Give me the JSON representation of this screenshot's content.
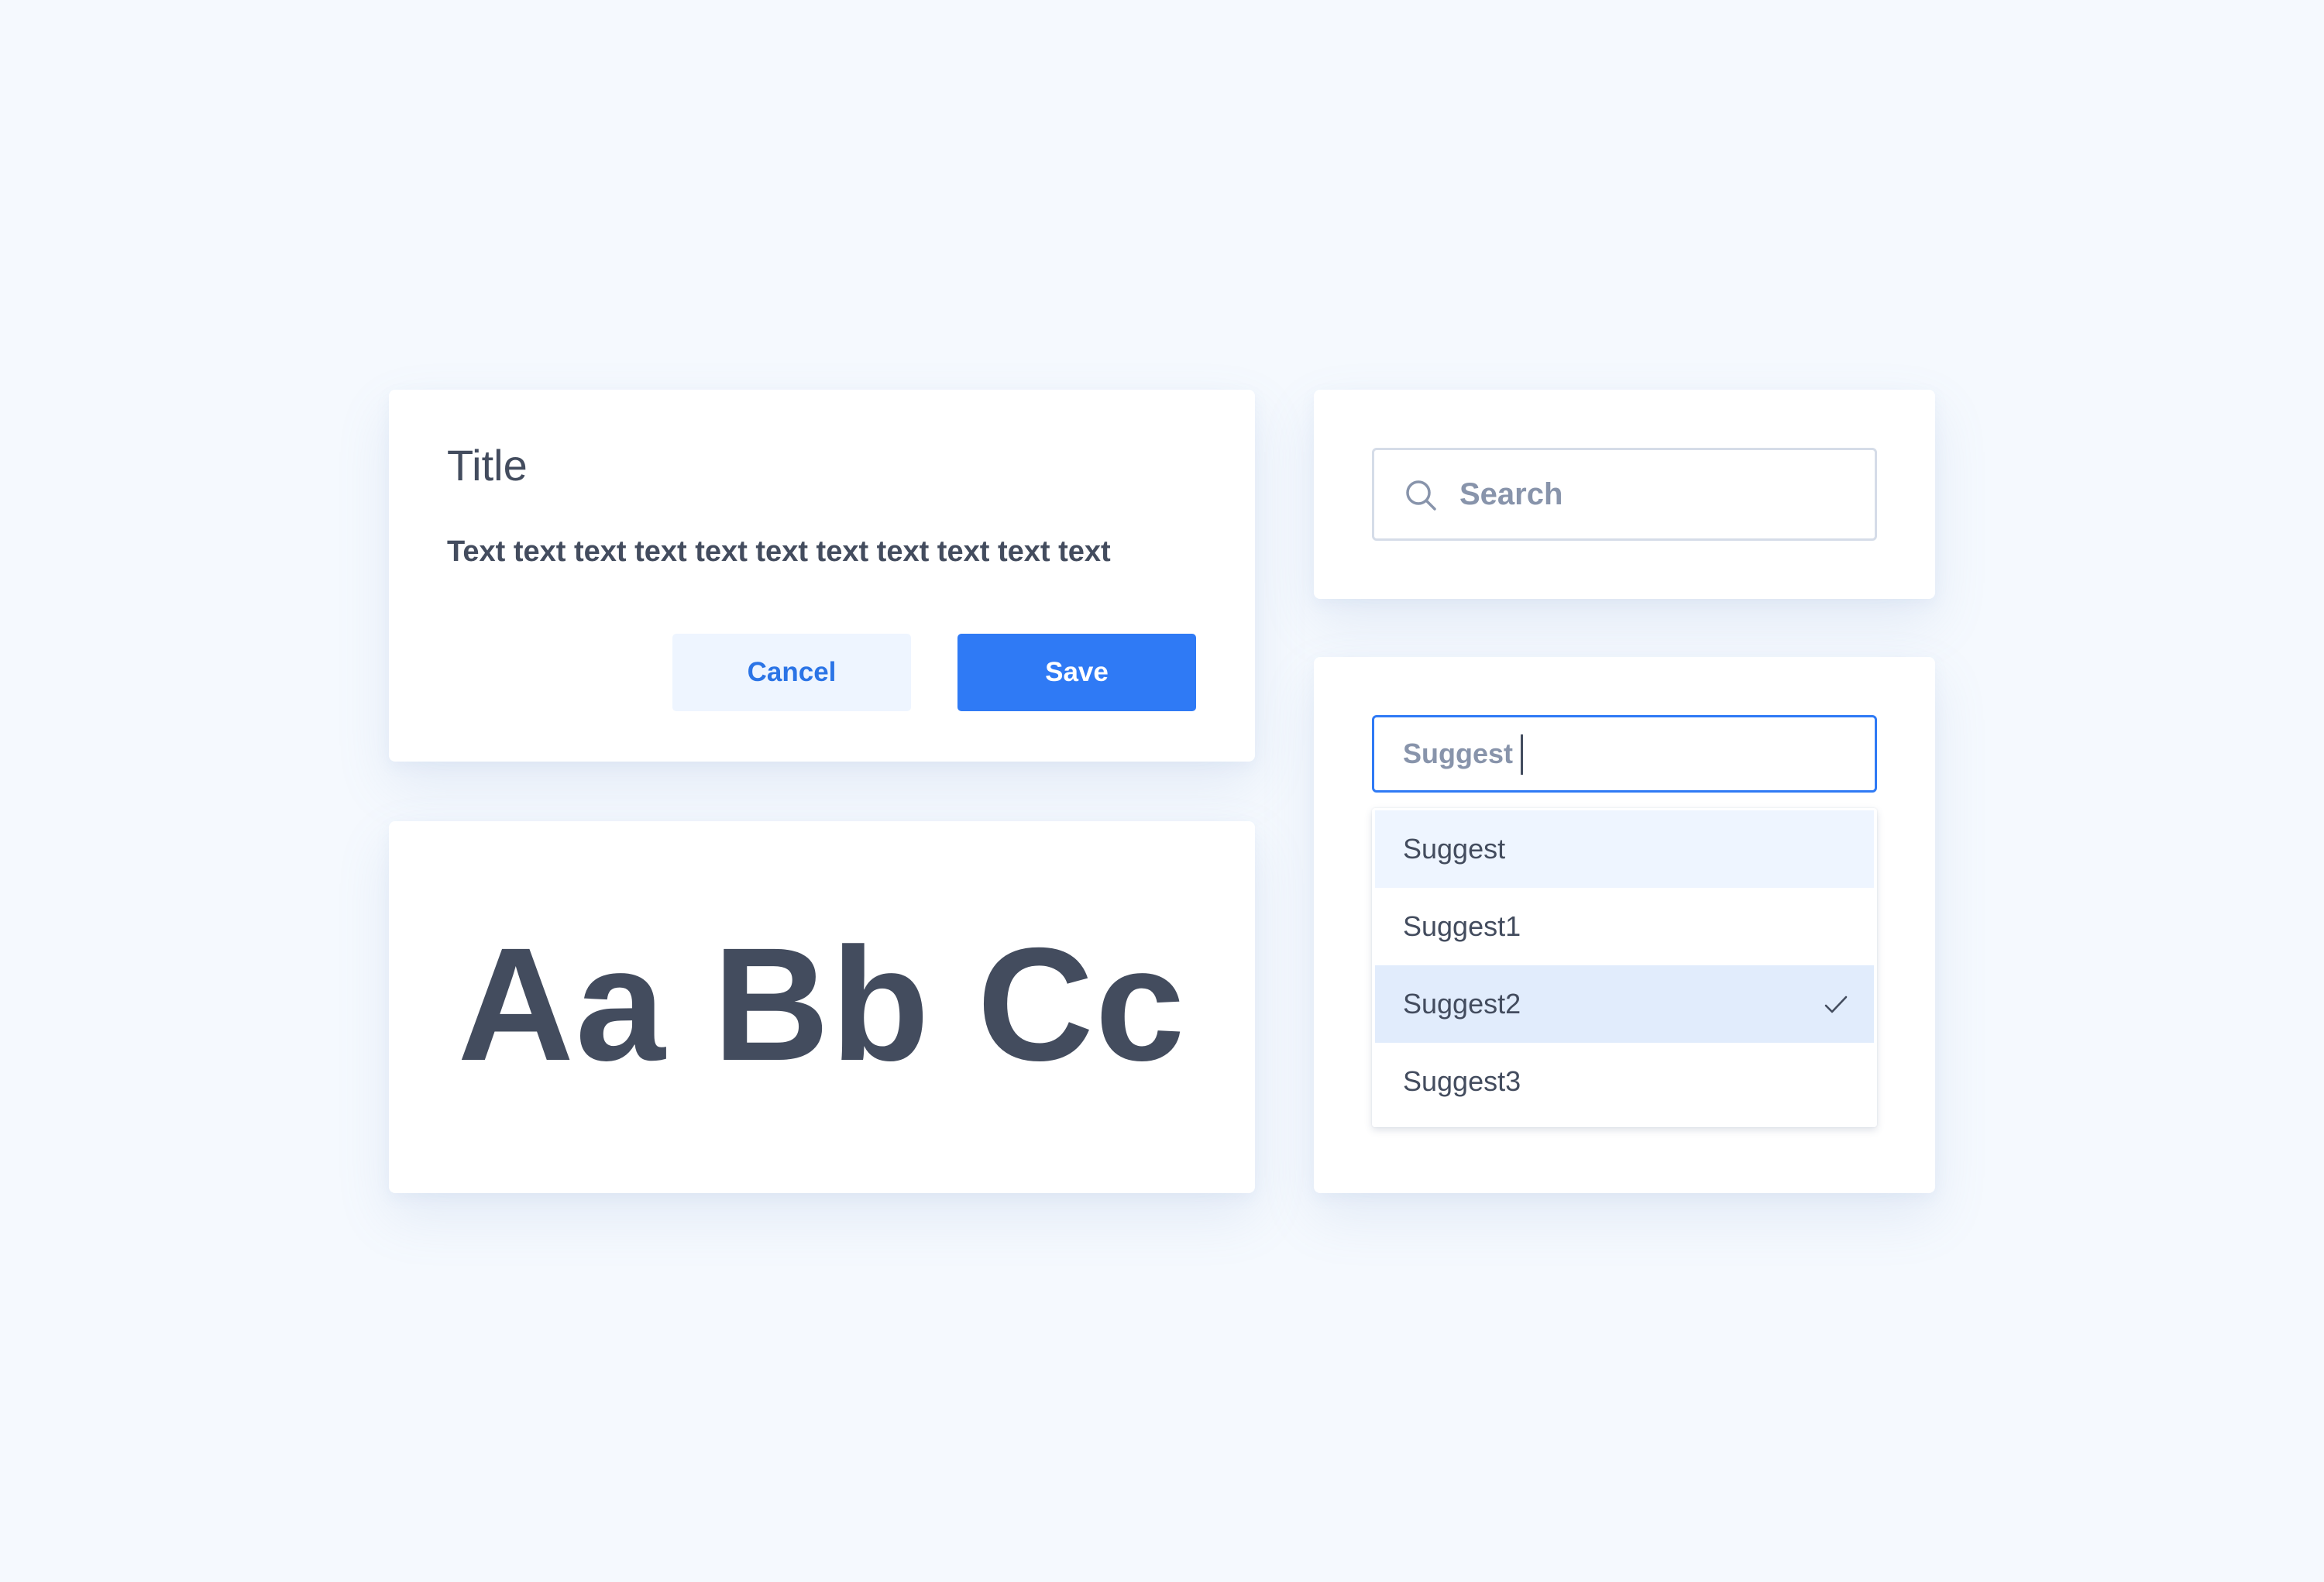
{
  "dialog": {
    "title": "Title",
    "text": "Text text text text text text text text text text text",
    "cancel_label": "Cancel",
    "save_label": "Save"
  },
  "typography": {
    "sample": "Aa Bb Cc"
  },
  "search": {
    "placeholder": "Search",
    "value": "",
    "icon": "search-icon"
  },
  "suggest": {
    "input_value": "Suggest",
    "items": [
      {
        "label": "Suggest",
        "state": "hover"
      },
      {
        "label": "Suggest1",
        "state": "normal"
      },
      {
        "label": "Suggest2",
        "state": "selected",
        "icon": "check-icon"
      },
      {
        "label": "Suggest3",
        "state": "normal"
      }
    ]
  },
  "colors": {
    "background": "#f5f9fe",
    "card": "#ffffff",
    "text": "#434c5e",
    "muted_text": "#8894ab",
    "primary": "#2f7af5",
    "primary_text_on_light": "#2b74e6",
    "secondary_button_bg": "#eef5ff",
    "hover_row": "#eef5ff",
    "selected_row": "#e1ecfc",
    "input_border": "#d5dce8"
  }
}
